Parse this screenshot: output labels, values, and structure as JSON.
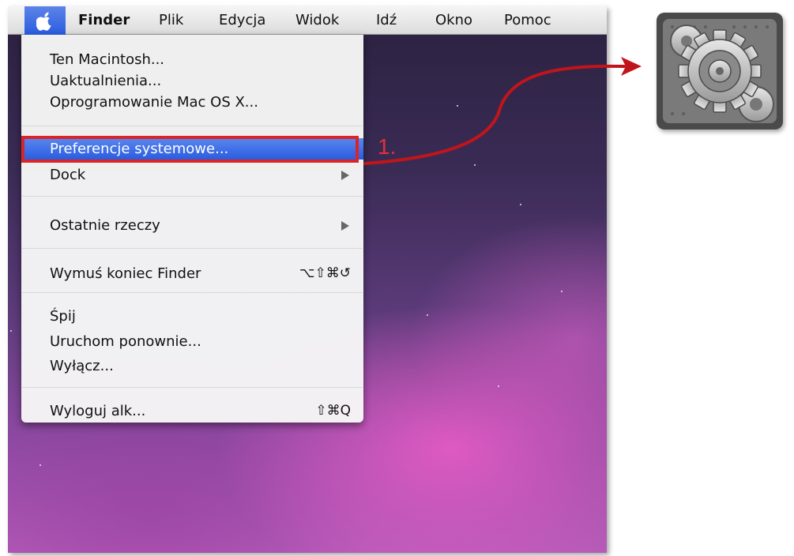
{
  "menubar": {
    "apple_icon": "apple-logo-icon",
    "items": [
      "Finder",
      "Plik",
      "Edycja",
      "Widok",
      "Idź",
      "Okno",
      "Pomoc"
    ]
  },
  "menu": {
    "about": "Ten Macintosh...",
    "updates": "Uaktualnienia...",
    "software": "Oprogramowanie Mac OS X...",
    "prefs": "Preferencje systemowe...",
    "dock": "Dock",
    "recent": "Ostatnie rzeczy",
    "force_quit": "Wymuś koniec Finder",
    "force_quit_shortcut": "⌥⇧⌘↺",
    "sleep": "Śpij",
    "restart": "Uruchom ponownie...",
    "shutdown": "Wyłącz...",
    "logout": "Wyloguj alk...",
    "logout_shortcut": "⇧⌘Q"
  },
  "annotation": {
    "step_label": "1.",
    "highlight_color": "#d9252a",
    "arrow_color": "#c0151b",
    "target_icon": "system-preferences-gear-icon"
  }
}
